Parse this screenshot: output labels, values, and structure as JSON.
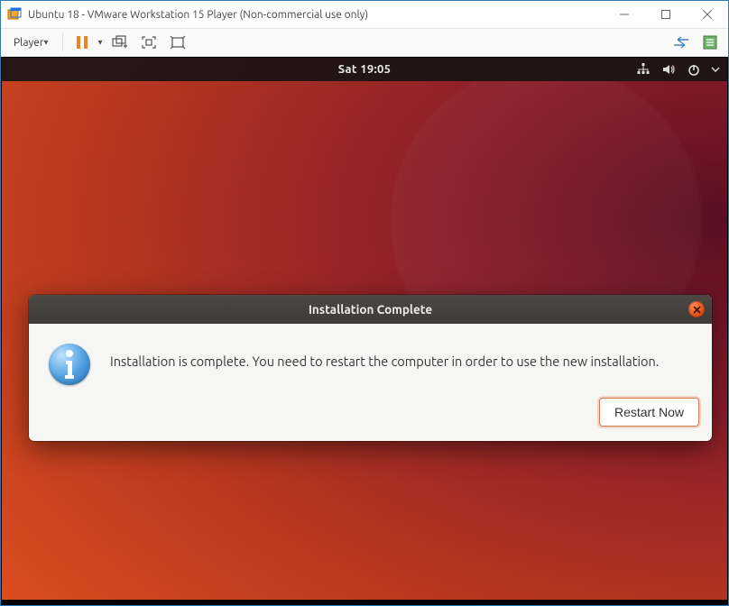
{
  "host": {
    "title": "Ubuntu 18 - VMware Workstation 15 Player (Non-commercial use only)",
    "player_menu": "Player"
  },
  "ubuntu": {
    "clock": "Sat 19:05"
  },
  "dialog": {
    "title": "Installation Complete",
    "message": "Installation is complete. You need to restart the computer in order to use the new installation.",
    "restart_label": "Restart Now"
  }
}
